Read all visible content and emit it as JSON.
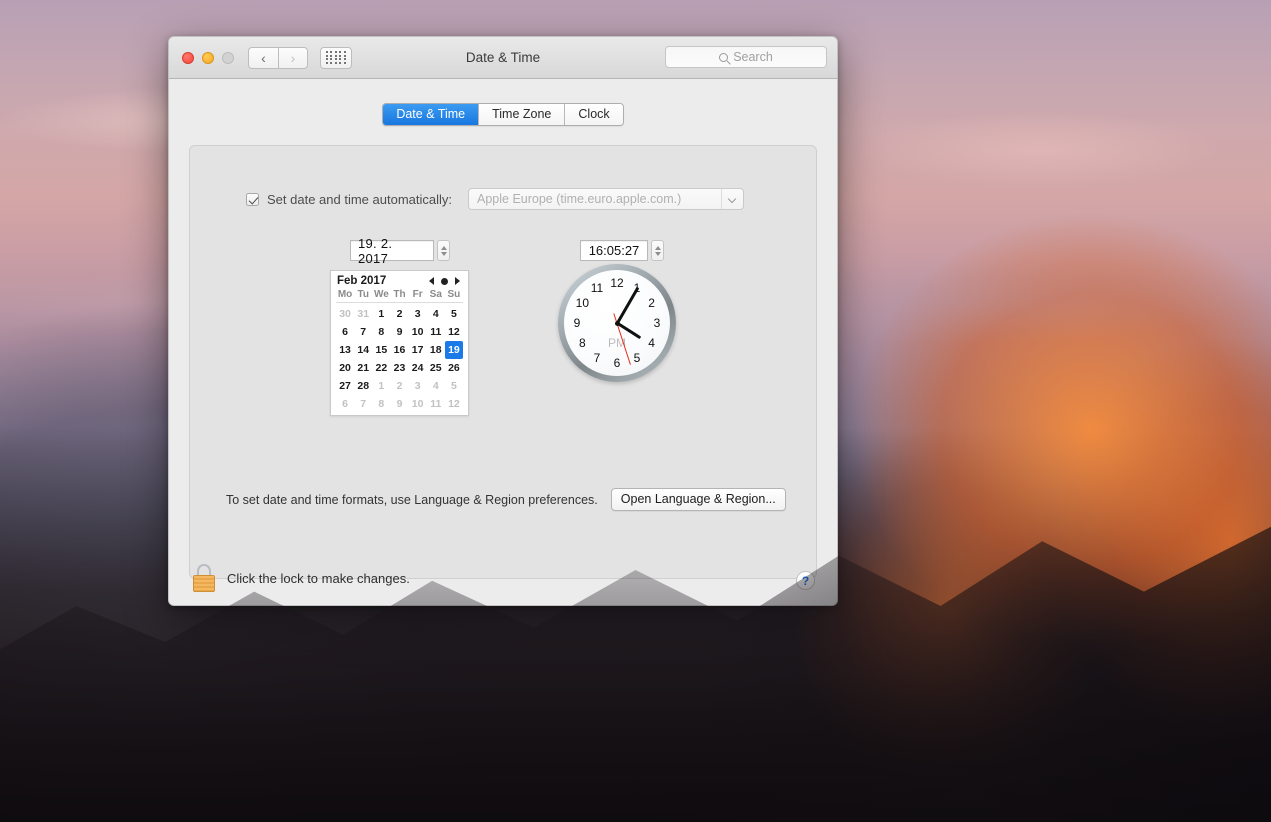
{
  "window": {
    "title": "Date & Time",
    "traffic_lights": [
      "close",
      "minimize",
      "zoom"
    ],
    "nav_back_icon": "chevron-left-icon",
    "nav_forward_icon": "chevron-right-icon",
    "grid_icon": "show-all-grid-icon"
  },
  "search": {
    "placeholder": "Search",
    "value": "",
    "icon": "search-icon"
  },
  "tabs": [
    {
      "label": "Date & Time",
      "active": true
    },
    {
      "label": "Time Zone",
      "active": false
    },
    {
      "label": "Clock",
      "active": false
    }
  ],
  "auto": {
    "checkbox_checked": true,
    "label": "Set date and time automatically:",
    "server": "Apple Europe (time.euro.apple.com.)",
    "dropdown_icon": "chevron-down-icon"
  },
  "date_field": {
    "value": "19. 2. 2017",
    "stepper_icon": "stepper-arrows-icon"
  },
  "time_field": {
    "value": "16:05:27",
    "stepper_icon": "stepper-arrows-icon"
  },
  "calendar": {
    "month_label": "Feb 2017",
    "nav_prev_icon": "triangle-left-icon",
    "nav_today_icon": "dot-icon",
    "nav_next_icon": "triangle-right-icon",
    "weekdays": [
      "Mo",
      "Tu",
      "We",
      "Th",
      "Fr",
      "Sa",
      "Su"
    ],
    "selected_day": 19,
    "weeks": [
      [
        {
          "d": 30,
          "out": true
        },
        {
          "d": 31,
          "out": true
        },
        {
          "d": 1
        },
        {
          "d": 2
        },
        {
          "d": 3
        },
        {
          "d": 4
        },
        {
          "d": 5
        }
      ],
      [
        {
          "d": 6
        },
        {
          "d": 7
        },
        {
          "d": 8
        },
        {
          "d": 9
        },
        {
          "d": 10
        },
        {
          "d": 11
        },
        {
          "d": 12
        }
      ],
      [
        {
          "d": 13
        },
        {
          "d": 14
        },
        {
          "d": 15
        },
        {
          "d": 16
        },
        {
          "d": 17
        },
        {
          "d": 18
        },
        {
          "d": 19,
          "sel": true
        }
      ],
      [
        {
          "d": 20
        },
        {
          "d": 21
        },
        {
          "d": 22
        },
        {
          "d": 23
        },
        {
          "d": 24
        },
        {
          "d": 25
        },
        {
          "d": 26
        }
      ],
      [
        {
          "d": 27
        },
        {
          "d": 28
        },
        {
          "d": 1,
          "out": true
        },
        {
          "d": 2,
          "out": true
        },
        {
          "d": 3,
          "out": true
        },
        {
          "d": 4,
          "out": true
        },
        {
          "d": 5,
          "out": true
        }
      ],
      [
        {
          "d": 6,
          "out": true
        },
        {
          "d": 7,
          "out": true
        },
        {
          "d": 8,
          "out": true
        },
        {
          "d": 9,
          "out": true
        },
        {
          "d": 10,
          "out": true
        },
        {
          "d": 11,
          "out": true
        },
        {
          "d": 12,
          "out": true
        }
      ]
    ]
  },
  "clock": {
    "numerals": [
      "12",
      "1",
      "2",
      "3",
      "4",
      "5",
      "6",
      "7",
      "8",
      "9",
      "10",
      "11"
    ],
    "meridiem": "PM",
    "hours": 4,
    "minutes": 5,
    "seconds": 27,
    "hour_angle": 122.5,
    "minute_angle": 30,
    "second_angle": 162
  },
  "formats": {
    "text": "To set date and time formats, use Language & Region preferences.",
    "button_label": "Open Language & Region..."
  },
  "footer": {
    "lock_icon": "lock-closed-icon",
    "lock_text": "Click the lock to make changes.",
    "help_label": "?",
    "help_icon": "help-question-icon"
  },
  "colors": {
    "accent_blue": "#1877e0",
    "selection_blue": "#1a7ae8",
    "second_hand_red": "#e8301f",
    "lock_orange": "#f4b860",
    "help_blue": "#1a73e8"
  }
}
